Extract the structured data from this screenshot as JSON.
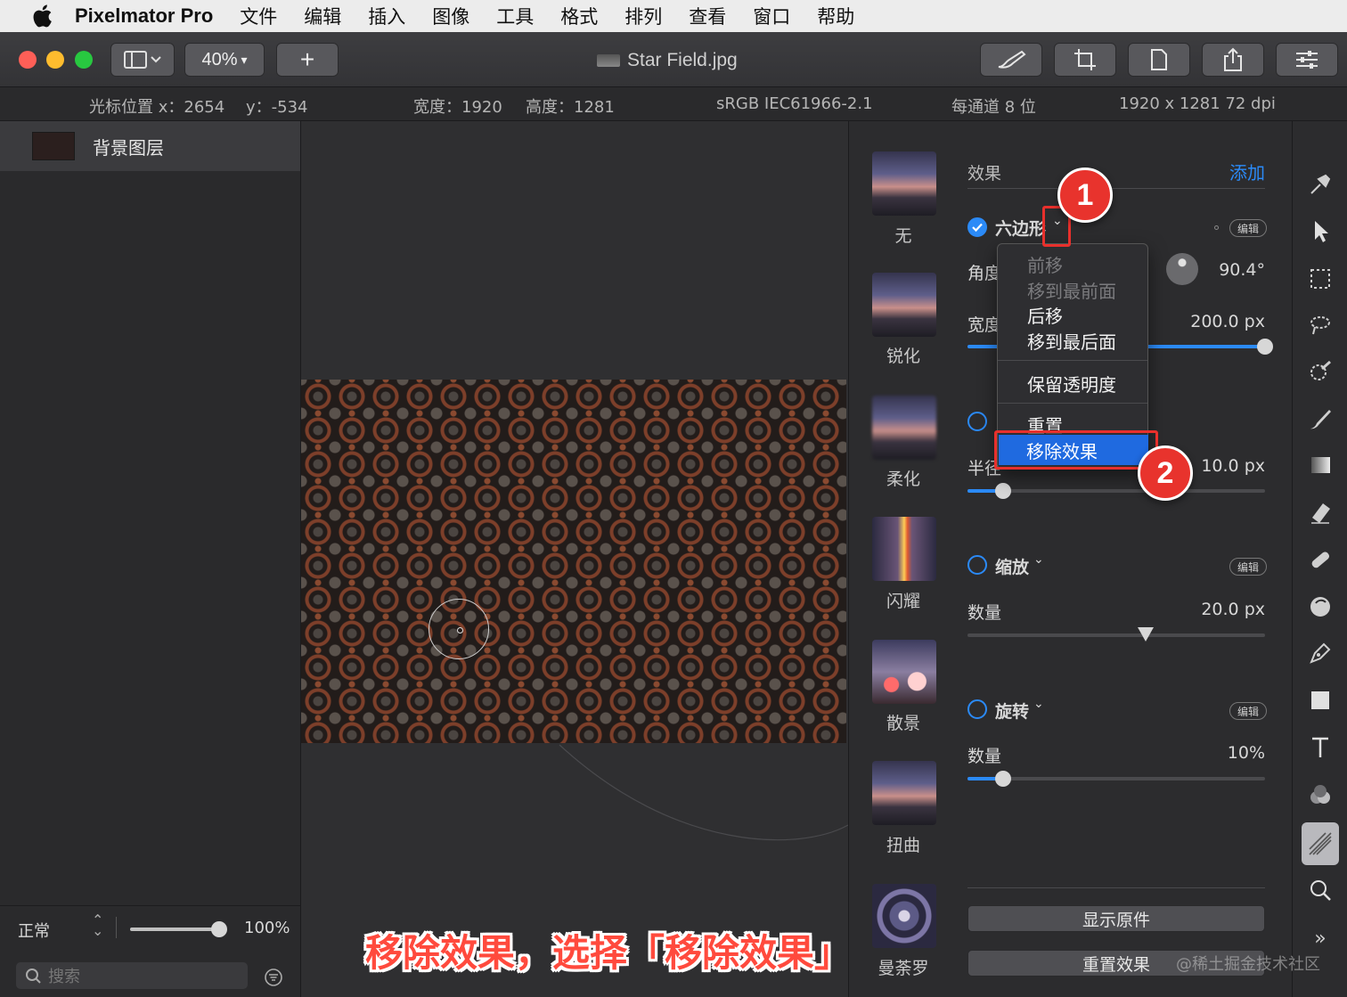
{
  "menubar": {
    "app_name": "Pixelmator Pro",
    "items": [
      "文件",
      "编辑",
      "插入",
      "图像",
      "工具",
      "格式",
      "排列",
      "查看",
      "窗口",
      "帮助"
    ]
  },
  "toolbar": {
    "zoom": "40%",
    "add_label": "+",
    "document_title": "Star Field.jpg"
  },
  "infobar": {
    "cursor_x": "光标位置 x：2654",
    "cursor_y": "y：-534",
    "width": "宽度：1920",
    "height": "高度：1281",
    "color_profile": "sRGB IEC61966-2.1",
    "bit_depth": "每通道 8 位",
    "dimensions": "1920 x 1281 72 dpi"
  },
  "layers": {
    "layer_name": "背景图层",
    "blend_mode": "正常",
    "opacity": "100%",
    "opacity_level": 1.0,
    "search_placeholder": "搜索"
  },
  "effect_browser": {
    "items": [
      "无",
      "锐化",
      "柔化",
      "闪耀",
      "散景",
      "扭曲",
      "曼荼罗"
    ]
  },
  "effects": {
    "header": "效果",
    "add_label": "添加",
    "edit_label": "编辑",
    "hexagon": {
      "name": "六边形",
      "angle_label": "角度",
      "angle_value": "90.4°",
      "width_label": "宽度",
      "width_value": "200.0 px",
      "width_level": 1.0
    },
    "radius_label": "半径",
    "radius_value": "10.0 px",
    "radius_level": 0.12,
    "zoom": {
      "name": "缩放",
      "amount_label": "数量",
      "amount_value": "20.0 px",
      "amount_level": 0.6
    },
    "rotate": {
      "name": "旋转",
      "amount_label": "数量",
      "amount_value": "10%",
      "amount_level": 0.12
    },
    "show_original": "显示原件",
    "reset_effects": "重置效果"
  },
  "dropdown": {
    "items": [
      "前移",
      "移到最前面",
      "后移",
      "移到最后面",
      "保留透明度",
      "重置",
      "移除效果"
    ]
  },
  "callouts": [
    "1",
    "2"
  ],
  "caption": "移除效果，选择「移除效果」",
  "watermark": "@稀土掘金技术社区",
  "colors": {
    "accent": "#2b8af7",
    "callout": "#e8332d",
    "menu_highlight": "#1f6ae0"
  }
}
